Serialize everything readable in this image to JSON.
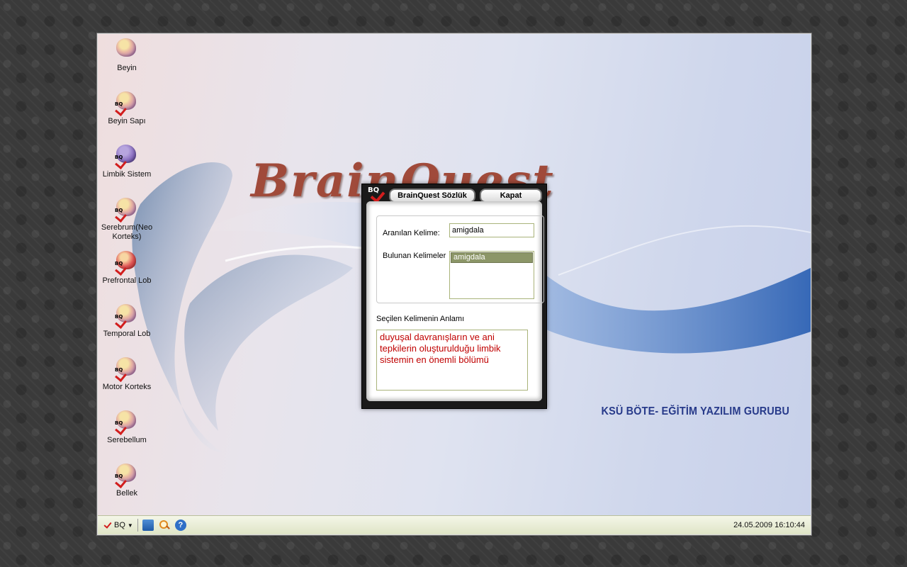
{
  "desktop": {
    "icons": [
      {
        "label": "Beyin",
        "icon": "brain-icon"
      },
      {
        "label": "Beyin Sapı",
        "icon": "brainstem-icon"
      },
      {
        "label": "Limbik Sistem",
        "icon": "limbic-system-icon"
      },
      {
        "label": "Serebrum(Neo Korteks)",
        "icon": "cerebrum-icon"
      },
      {
        "label": "Prefrontal Lob",
        "icon": "prefrontal-lobe-icon"
      },
      {
        "label": "Temporal Lob",
        "icon": "temporal-lobe-icon"
      },
      {
        "label": "Motor Korteks",
        "icon": "motor-cortex-icon"
      },
      {
        "label": "Serebellum",
        "icon": "cerebellum-icon"
      },
      {
        "label": "Bellek",
        "icon": "memory-icon"
      }
    ],
    "logo_text": "BrainQuest",
    "footer_brand": "KSÜ BÖTE- EĞİTİM YAZILIM GURUBU"
  },
  "dialog": {
    "logo_text": "BQ",
    "title": "BrainQuest Sözlük",
    "close_label": "Kapat",
    "search_label": "Aranılan Kelime:",
    "search_value": "amigdala",
    "found_label": "Bulunan Kelimeler",
    "found_items": [
      "amigdala"
    ],
    "meaning_label": "Seçilen Kelimenin Anlamı",
    "meaning_text": "duyuşal davranışların ve ani tepkilerin oluşturulduğu limbik sistemin en önemli bölümü"
  },
  "taskbar": {
    "start_label": "BQ",
    "start_icon": "bq-logo-icon",
    "quick_icons": [
      "book-icon",
      "search-icon",
      "help-icon"
    ],
    "clock": "24.05.2009 16:10:44"
  },
  "colors": {
    "meaning_text": "#c00000",
    "brand_footer": "#273a8a",
    "list_selection": "#8c9668"
  }
}
